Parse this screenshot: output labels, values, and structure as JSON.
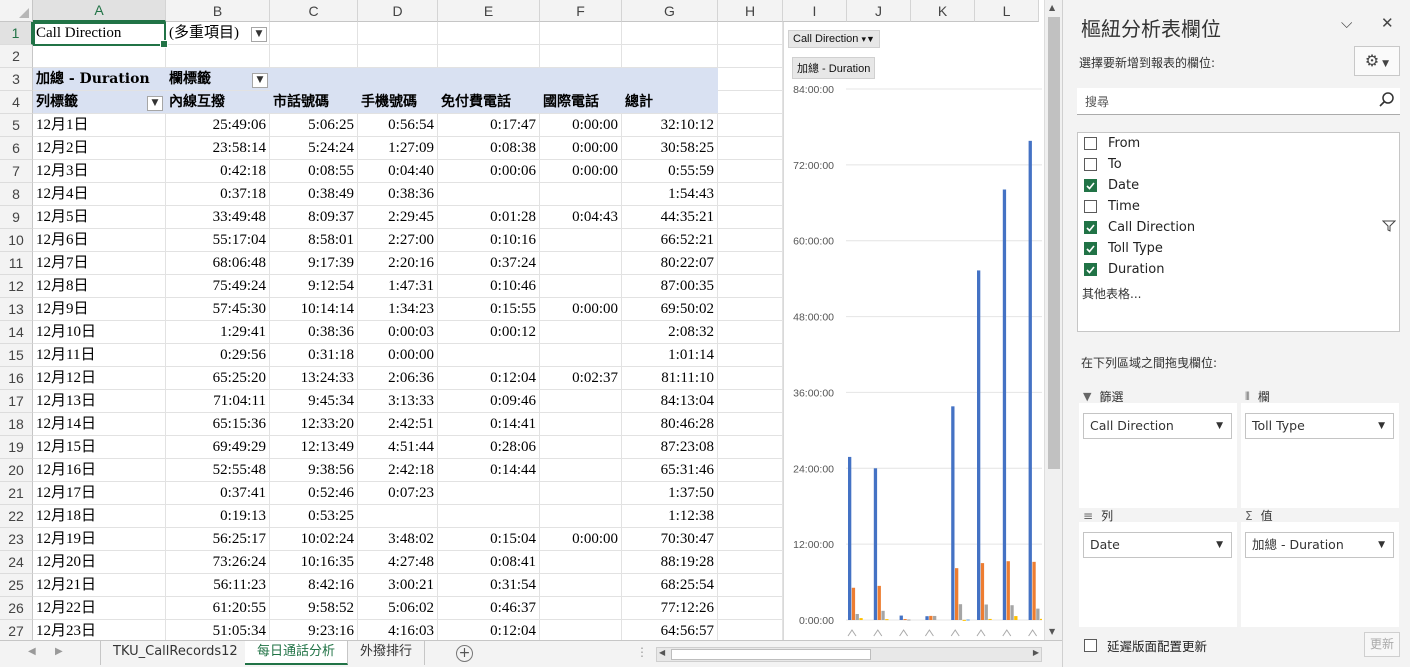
{
  "sheet": {
    "columns": [
      "A",
      "B",
      "C",
      "D",
      "E",
      "F",
      "G",
      "H",
      "I",
      "J",
      "K",
      "L"
    ],
    "rows": [
      "1",
      "2",
      "3",
      "4",
      "5",
      "6",
      "7",
      "8",
      "9",
      "10",
      "11",
      "12",
      "13",
      "14",
      "15",
      "16",
      "17",
      "18",
      "19",
      "20",
      "21",
      "22",
      "23",
      "24",
      "25",
      "26",
      "27"
    ],
    "filter": {
      "field": "Call Direction",
      "value": "(多重項目)"
    },
    "pivot_header": {
      "values_label": "加總 - Duration",
      "col_label": "欄標籤",
      "row_label": "列標籤"
    },
    "col_headers": [
      "內線互撥",
      "市話號碼",
      "手機號碼",
      "免付費電話",
      "國際電話",
      "總計"
    ],
    "data": [
      [
        "12月1日",
        "25:49:06",
        "5:06:25",
        "0:56:54",
        "0:17:47",
        "0:00:00",
        "32:10:12"
      ],
      [
        "12月2日",
        "23:58:14",
        "5:24:24",
        "1:27:09",
        "0:08:38",
        "0:00:00",
        "30:58:25"
      ],
      [
        "12月3日",
        "0:42:18",
        "0:08:55",
        "0:04:40",
        "0:00:06",
        "0:00:00",
        "0:55:59"
      ],
      [
        "12月4日",
        "0:37:18",
        "0:38:49",
        "0:38:36",
        "",
        "",
        "1:54:43"
      ],
      [
        "12月5日",
        "33:49:48",
        "8:09:37",
        "2:29:45",
        "0:01:28",
        "0:04:43",
        "44:35:21"
      ],
      [
        "12月6日",
        "55:17:04",
        "8:58:01",
        "2:27:00",
        "0:10:16",
        "",
        "66:52:21"
      ],
      [
        "12月7日",
        "68:06:48",
        "9:17:39",
        "2:20:16",
        "0:37:24",
        "",
        "80:22:07"
      ],
      [
        "12月8日",
        "75:49:24",
        "9:12:54",
        "1:47:31",
        "0:10:46",
        "",
        "87:00:35"
      ],
      [
        "12月9日",
        "57:45:30",
        "10:14:14",
        "1:34:23",
        "0:15:55",
        "0:00:00",
        "69:50:02"
      ],
      [
        "12月10日",
        "1:29:41",
        "0:38:36",
        "0:00:03",
        "0:00:12",
        "",
        "2:08:32"
      ],
      [
        "12月11日",
        "0:29:56",
        "0:31:18",
        "0:00:00",
        "",
        "",
        "1:01:14"
      ],
      [
        "12月12日",
        "65:25:20",
        "13:24:33",
        "2:06:36",
        "0:12:04",
        "0:02:37",
        "81:11:10"
      ],
      [
        "12月13日",
        "71:04:11",
        "9:45:34",
        "3:13:33",
        "0:09:46",
        "",
        "84:13:04"
      ],
      [
        "12月14日",
        "65:15:36",
        "12:33:20",
        "2:42:51",
        "0:14:41",
        "",
        "80:46:28"
      ],
      [
        "12月15日",
        "69:49:29",
        "12:13:49",
        "4:51:44",
        "0:28:06",
        "",
        "87:23:08"
      ],
      [
        "12月16日",
        "52:55:48",
        "9:38:56",
        "2:42:18",
        "0:14:44",
        "",
        "65:31:46"
      ],
      [
        "12月17日",
        "0:37:41",
        "0:52:46",
        "0:07:23",
        "",
        "",
        "1:37:50"
      ],
      [
        "12月18日",
        "0:19:13",
        "0:53:25",
        "",
        "",
        "",
        "1:12:38"
      ],
      [
        "12月19日",
        "56:25:17",
        "10:02:24",
        "3:48:02",
        "0:15:04",
        "0:00:00",
        "70:30:47"
      ],
      [
        "12月20日",
        "73:26:24",
        "10:16:35",
        "4:27:48",
        "0:08:41",
        "",
        "88:19:28"
      ],
      [
        "12月21日",
        "56:11:23",
        "8:42:16",
        "3:00:21",
        "0:31:54",
        "",
        "68:25:54"
      ],
      [
        "12月22日",
        "61:20:55",
        "9:58:52",
        "5:06:02",
        "0:46:37",
        "",
        "77:12:26"
      ],
      [
        "12月23日",
        "51:05:34",
        "9:23:16",
        "4:16:03",
        "0:12:04",
        "",
        "64:56:57"
      ]
    ]
  },
  "chart_data": {
    "type": "bar",
    "filter_button": "Call Direction",
    "values_button": "加總 - Duration",
    "ylabels": [
      "0:00:00",
      "12:00:00",
      "24:00:00",
      "36:00:00",
      "48:00:00",
      "60:00:00",
      "72:00:00",
      "84:00:00"
    ],
    "ylim_hours": [
      0,
      84
    ],
    "series": [
      {
        "name": "內線互撥",
        "color": "#4472c4",
        "values": [
          25.8,
          24.0,
          0.7,
          0.6,
          33.8,
          55.3,
          68.1,
          75.8
        ]
      },
      {
        "name": "市話號碼",
        "color": "#ed7d31",
        "values": [
          5.1,
          5.4,
          0.15,
          0.65,
          8.2,
          9.0,
          9.3,
          9.2
        ]
      },
      {
        "name": "手機號碼",
        "color": "#a5a5a5",
        "values": [
          0.95,
          1.45,
          0.08,
          0.64,
          2.5,
          2.45,
          2.34,
          1.8
        ]
      },
      {
        "name": "免付費電話",
        "color": "#ffc000",
        "values": [
          0.3,
          0.14,
          0.0,
          0.0,
          0.02,
          0.17,
          0.62,
          0.18
        ]
      },
      {
        "name": "國際電話",
        "color": "#5b9bd5",
        "values": [
          0,
          0,
          0,
          0,
          0.08,
          0,
          0,
          0
        ]
      }
    ]
  },
  "tabs": {
    "items": [
      "TKU_CallRecords12",
      "每日通話分析",
      "外撥排行"
    ],
    "active": 1
  },
  "pane": {
    "title": "樞紐分析表欄位",
    "subtitle": "選擇要新增到報表的欄位:",
    "search_placeholder": "搜尋",
    "fields": [
      {
        "label": "From",
        "checked": false
      },
      {
        "label": "To",
        "checked": false
      },
      {
        "label": "Date",
        "checked": true
      },
      {
        "label": "Time",
        "checked": false
      },
      {
        "label": "Call Direction",
        "checked": true
      },
      {
        "label": "Toll Type",
        "checked": true
      },
      {
        "label": "Duration",
        "checked": true
      }
    ],
    "more_tables": "其他表格...",
    "drag_label": "在下列區域之間拖曳欄位:",
    "areas": {
      "filter": {
        "title": "篩選",
        "item": "Call Direction"
      },
      "columns": {
        "title": "欄",
        "item": "Toll Type"
      },
      "rows": {
        "title": "列",
        "item": "Date"
      },
      "values": {
        "title": "值",
        "item": "加總 - Duration"
      }
    },
    "defer_label": "延遲版面配置更新",
    "update_button": "更新"
  }
}
